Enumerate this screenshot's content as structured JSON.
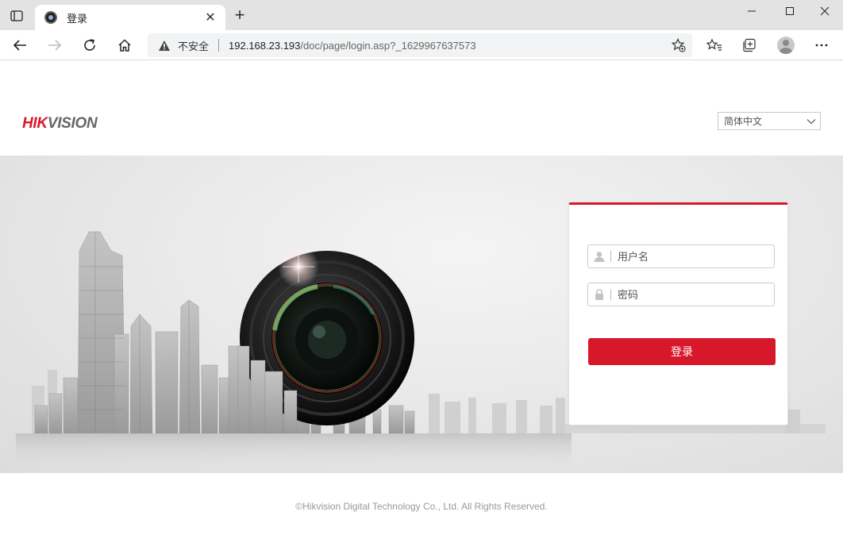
{
  "browser": {
    "tab": {
      "title": "登录",
      "favicon": "camera-favicon-icon",
      "close_icon": "close-icon"
    },
    "new_tab_icon": "plus-icon",
    "address": {
      "security_label": "不安全",
      "url_host": "192.168.23.193",
      "url_path": "/doc/page/login.asp?_1629967637573"
    },
    "buttons": [
      "back-icon",
      "forward-icon",
      "refresh-icon",
      "home-icon",
      "add-favorite-icon",
      "favorites-icon",
      "collections-icon",
      "profile-avatar",
      "more-icon"
    ],
    "window_controls": [
      "minimize-icon",
      "maximize-icon",
      "close-window-icon"
    ]
  },
  "page": {
    "logo": {
      "part1": "HIK",
      "part2": "VISION"
    },
    "language": {
      "selected": "简体中文"
    },
    "login": {
      "username_placeholder": "用户名",
      "password_placeholder": "密码",
      "submit_label": "登录"
    },
    "footer": {
      "copyright": "©Hikvision Digital Technology Co., Ltd. All Rights Reserved."
    }
  },
  "colors": {
    "brand_red": "#d7182a",
    "logo_gray": "#666666",
    "tab_bar": "#e3e3e3",
    "address_bar": "#f1f3f4"
  }
}
